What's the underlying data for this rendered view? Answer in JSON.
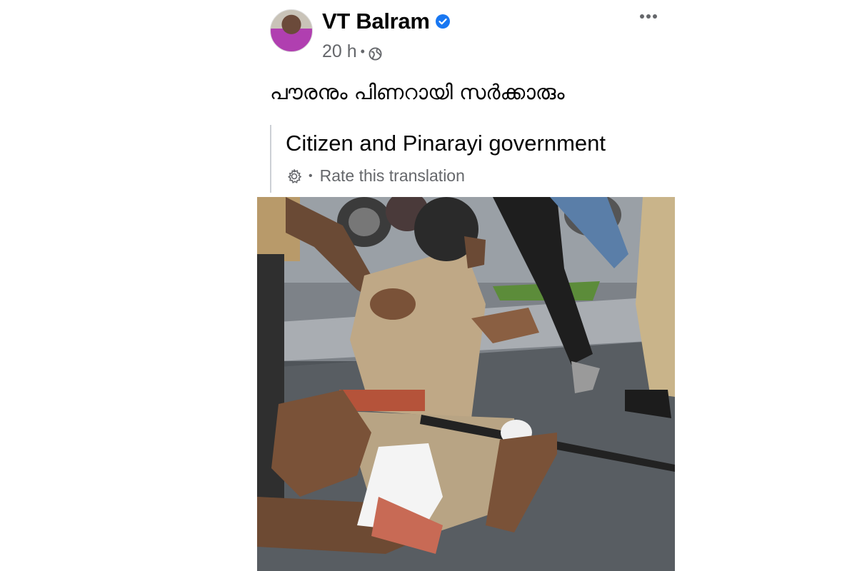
{
  "post": {
    "author": "VT Balram",
    "timestamp": "20 h",
    "privacy_icon": "globe-icon",
    "verified_icon": "verified-badge-icon",
    "more_icon": "more-options-icon",
    "text": "പൗരനും പിണറായി സർക്കാരും",
    "translation": {
      "text": "Citizen and Pinarayi government",
      "rate_label": "Rate this translation",
      "icon": "gear-icon"
    },
    "photo": {
      "alt": "Photo"
    }
  },
  "colors": {
    "primary_text": "#050505",
    "secondary_text": "#65676b",
    "verified_blue": "#1877f2",
    "divider": "#ccd0d5"
  }
}
